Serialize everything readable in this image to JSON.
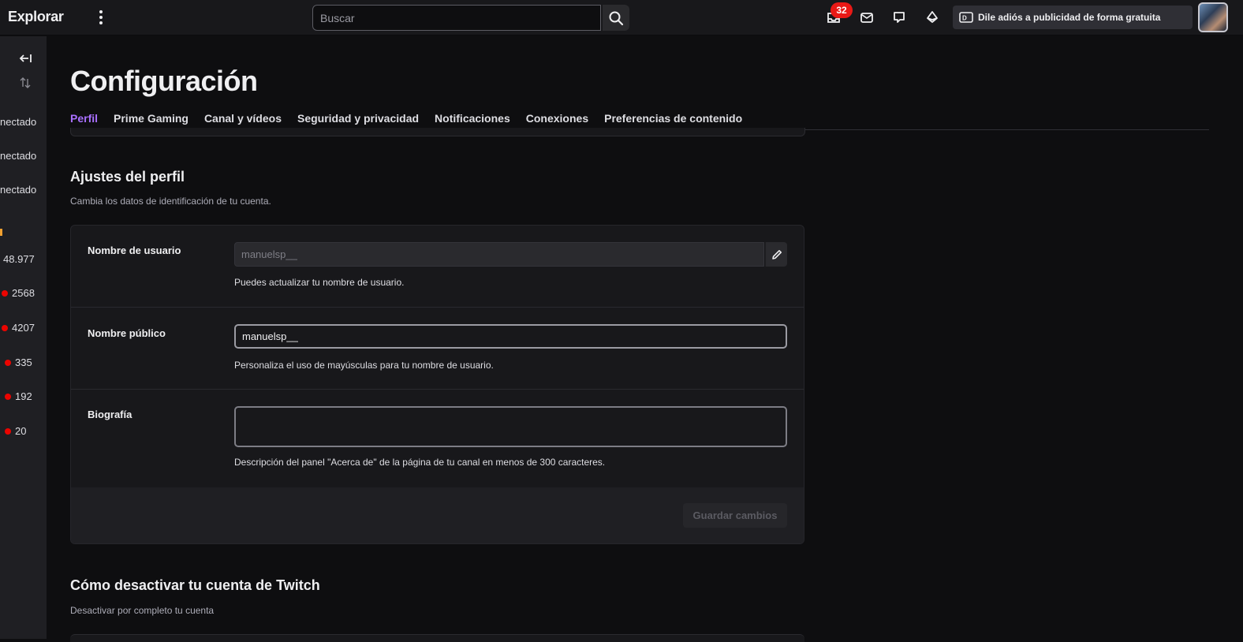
{
  "topnav": {
    "brand": "Explorar",
    "search_placeholder": "Buscar",
    "notifications_count": "32",
    "adfree_label": "Dile adiós a publicidad de forma gratuita"
  },
  "sidebar": {
    "status_items": [
      "nectado",
      "nectado",
      "nectado"
    ],
    "viewer_counts": [
      "48.977",
      "2568",
      "4207",
      "335",
      "192",
      "20"
    ]
  },
  "page": {
    "title": "Configuración",
    "tabs": [
      {
        "label": "Perfil",
        "active": true
      },
      {
        "label": "Prime Gaming",
        "active": false
      },
      {
        "label": "Canal y vídeos",
        "active": false
      },
      {
        "label": "Seguridad y privacidad",
        "active": false
      },
      {
        "label": "Notificaciones",
        "active": false
      },
      {
        "label": "Conexiones",
        "active": false
      },
      {
        "label": "Preferencias de contenido",
        "active": false
      }
    ]
  },
  "profile": {
    "title": "Ajustes del perfil",
    "subtitle": "Cambia los datos de identificación de tu cuenta.",
    "username_label": "Nombre de usuario",
    "username_value": "manuelsp__",
    "username_hint": "Puedes actualizar tu nombre de usuario.",
    "display_label": "Nombre público",
    "display_value": "manuelsp__",
    "display_hint": "Personaliza el uso de mayúsculas para tu nombre de usuario.",
    "bio_label": "Biografía",
    "bio_value": "",
    "bio_hint": "Descripción del panel \"Acerca de\" de la página de tu canal en menos de 300 caracteres.",
    "save_label": "Guardar cambios"
  },
  "deactivate": {
    "title": "Cómo desactivar tu cuenta de Twitch",
    "subtitle": "Desactivar por completo tu cuenta"
  },
  "colors": {
    "accent": "#a970ff",
    "live": "#eb0400",
    "badge": "#e91916"
  }
}
